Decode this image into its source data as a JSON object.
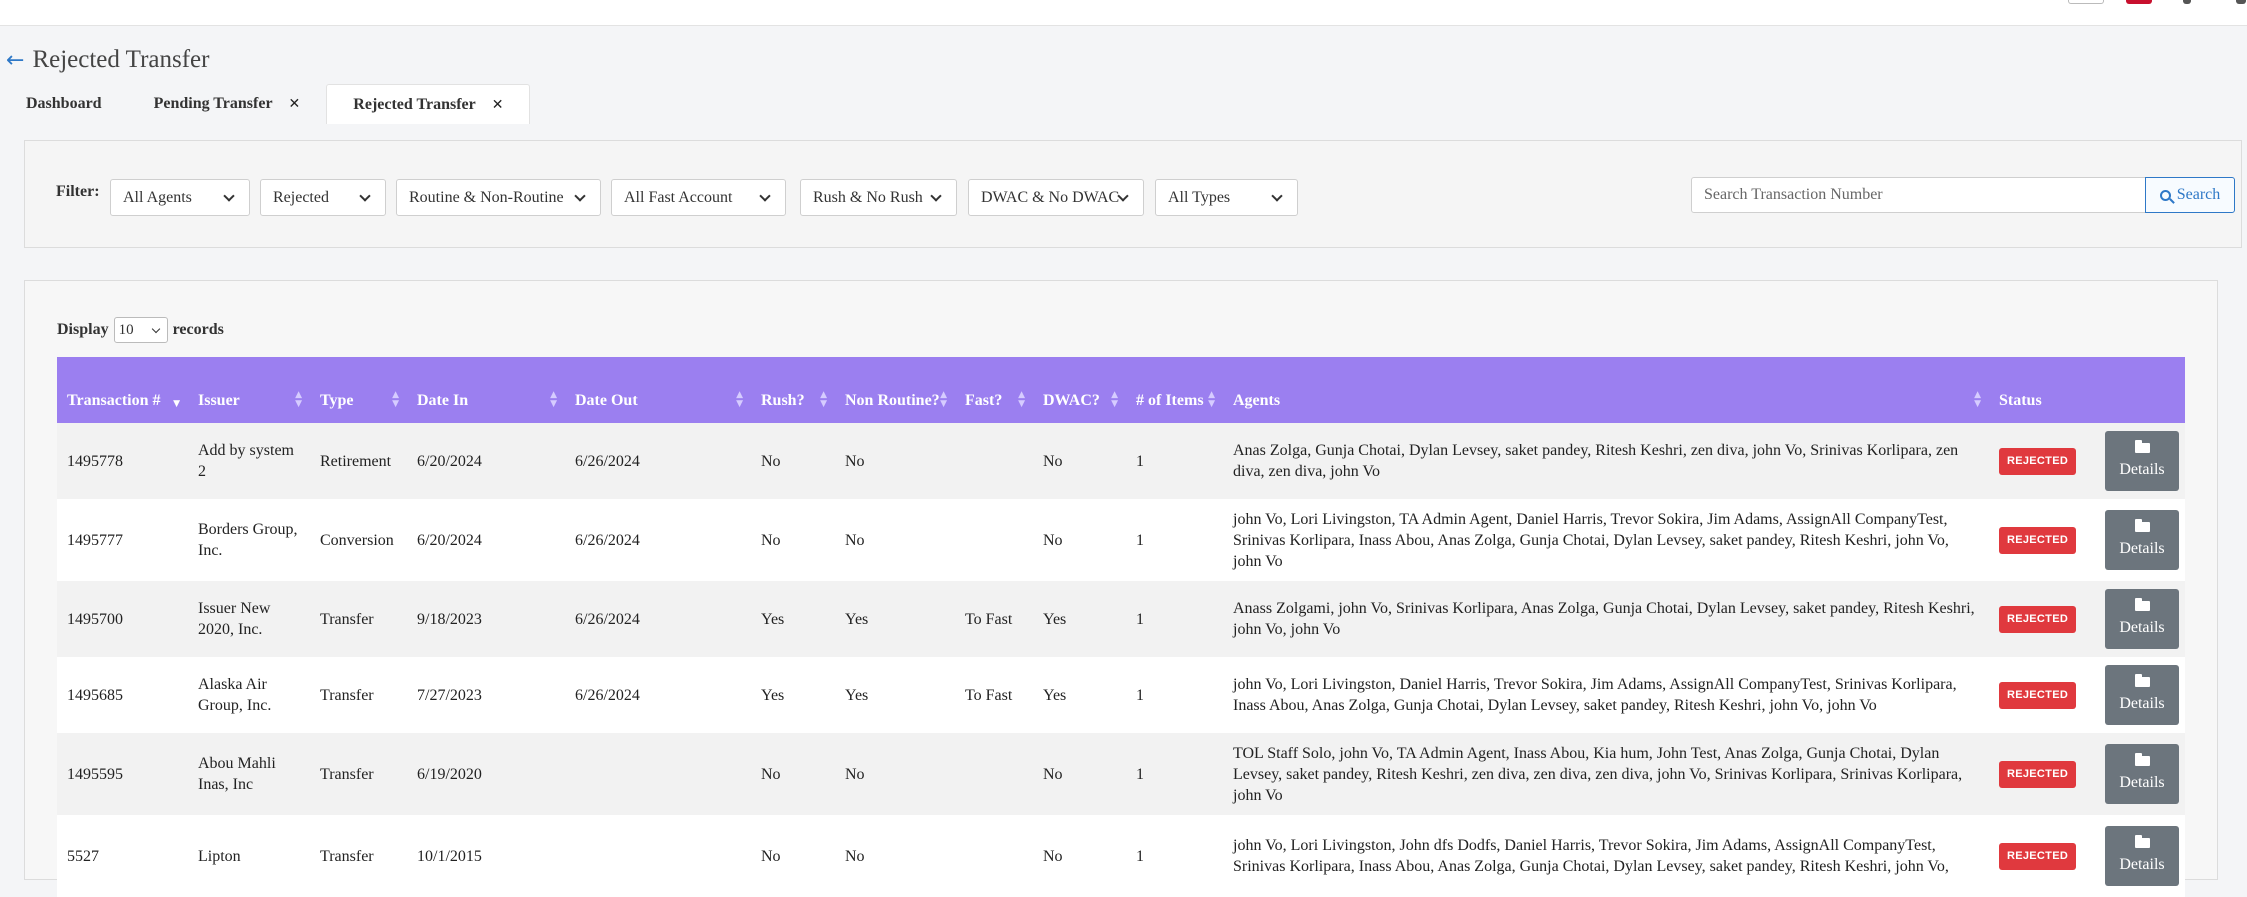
{
  "page": {
    "title": "Rejected Transfer"
  },
  "tabs": [
    {
      "label": "Dashboard",
      "closable": false,
      "active": false
    },
    {
      "label": "Pending Transfer",
      "closable": true,
      "active": false
    },
    {
      "label": "Rejected Transfer",
      "closable": true,
      "active": true
    }
  ],
  "filter": {
    "label": "Filter:",
    "dropdowns": [
      "All Agents",
      "Rejected",
      "Routine & Non-Routine",
      "All Fast Account",
      "Rush & No Rush",
      "DWAC & No DWAC",
      "All Types"
    ],
    "search_placeholder": "Search Transaction Number",
    "search_button": "Search"
  },
  "display": {
    "prefix": "Display",
    "value": "10",
    "suffix": "records"
  },
  "table": {
    "columns": [
      "Transaction #",
      "Issuer",
      "Type",
      "Date In",
      "Date Out",
      "Rush?",
      "Non Routine?",
      "Fast?",
      "DWAC?",
      "# of Items",
      "Agents",
      "Status",
      ""
    ],
    "rows": [
      {
        "transaction": "1495778",
        "issuer": "Add by system 2",
        "type": "Retirement",
        "date_in": "6/20/2024",
        "date_out": "6/26/2024",
        "rush": "No",
        "non_routine": "No",
        "fast": "",
        "dwac": "No",
        "items": "1",
        "agents": "Anas Zolga, Gunja Chotai, Dylan Levsey, saket pandey, Ritesh Keshri, zen diva, john Vo, Srinivas Korlipara, zen diva, zen diva, john Vo",
        "status": "REJECTED",
        "action": "Details"
      },
      {
        "transaction": "1495777",
        "issuer": "Borders Group, Inc.",
        "type": "Conversion",
        "date_in": "6/20/2024",
        "date_out": "6/26/2024",
        "rush": "No",
        "non_routine": "No",
        "fast": "",
        "dwac": "No",
        "items": "1",
        "agents": "john Vo, Lori Livingston, TA Admin Agent, Daniel Harris, Trevor Sokira, Jim Adams, AssignAll CompanyTest, Srinivas Korlipara, Inass Abou, Anas Zolga, Gunja Chotai, Dylan Levsey, saket pandey, Ritesh Keshri, john Vo, john Vo",
        "status": "REJECTED",
        "action": "Details"
      },
      {
        "transaction": "1495700",
        "issuer": "Issuer New 2020, Inc.",
        "type": "Transfer",
        "date_in": "9/18/2023",
        "date_out": "6/26/2024",
        "rush": "Yes",
        "non_routine": "Yes",
        "fast": "To Fast",
        "dwac": "Yes",
        "items": "1",
        "agents": "Anass Zolgami, john Vo, Srinivas Korlipara, Anas Zolga, Gunja Chotai, Dylan Levsey, saket pandey, Ritesh Keshri, john Vo, john Vo",
        "status": "REJECTED",
        "action": "Details"
      },
      {
        "transaction": "1495685",
        "issuer": "Alaska Air Group, Inc.",
        "type": "Transfer",
        "date_in": "7/27/2023",
        "date_out": "6/26/2024",
        "rush": "Yes",
        "non_routine": "Yes",
        "fast": "To Fast",
        "dwac": "Yes",
        "items": "1",
        "agents": "john Vo, Lori Livingston, Daniel Harris, Trevor Sokira, Jim Adams, AssignAll CompanyTest, Srinivas Korlipara, Inass Abou, Anas Zolga, Gunja Chotai, Dylan Levsey, saket pandey, Ritesh Keshri, john Vo, john Vo",
        "status": "REJECTED",
        "action": "Details"
      },
      {
        "transaction": "1495595",
        "issuer": "Abou Mahli Inas, Inc",
        "type": "Transfer",
        "date_in": "6/19/2020",
        "date_out": "",
        "rush": "No",
        "non_routine": "No",
        "fast": "",
        "dwac": "No",
        "items": "1",
        "agents": "TOL Staff Solo, john Vo, TA Admin Agent, Inass Abou, Kia hum, John Test, Anas Zolga, Gunja Chotai, Dylan Levsey, saket pandey, Ritesh Keshri, zen diva, zen diva, zen diva, john Vo, Srinivas Korlipara, Srinivas Korlipara, john Vo",
        "status": "REJECTED",
        "action": "Details"
      },
      {
        "transaction": "5527",
        "issuer": "Lipton",
        "type": "Transfer",
        "date_in": "10/1/2015",
        "date_out": "",
        "rush": "No",
        "non_routine": "No",
        "fast": "",
        "dwac": "No",
        "items": "1",
        "agents": "john Vo, Lori Livingston, John dfs Dodfs, Daniel Harris, Trevor Sokira, Jim Adams, AssignAll CompanyTest, Srinivas Korlipara, Inass Abou, Anas Zolga, Gunja Chotai, Dylan Levsey, saket pandey, Ritesh Keshri, john Vo,",
        "status": "REJECTED",
        "action": "Details"
      }
    ]
  },
  "colors": {
    "header_purple": "#9b7ff0",
    "rejected_red": "#e0393e",
    "details_gray": "#6c757d",
    "link_blue": "#2e78c7"
  }
}
